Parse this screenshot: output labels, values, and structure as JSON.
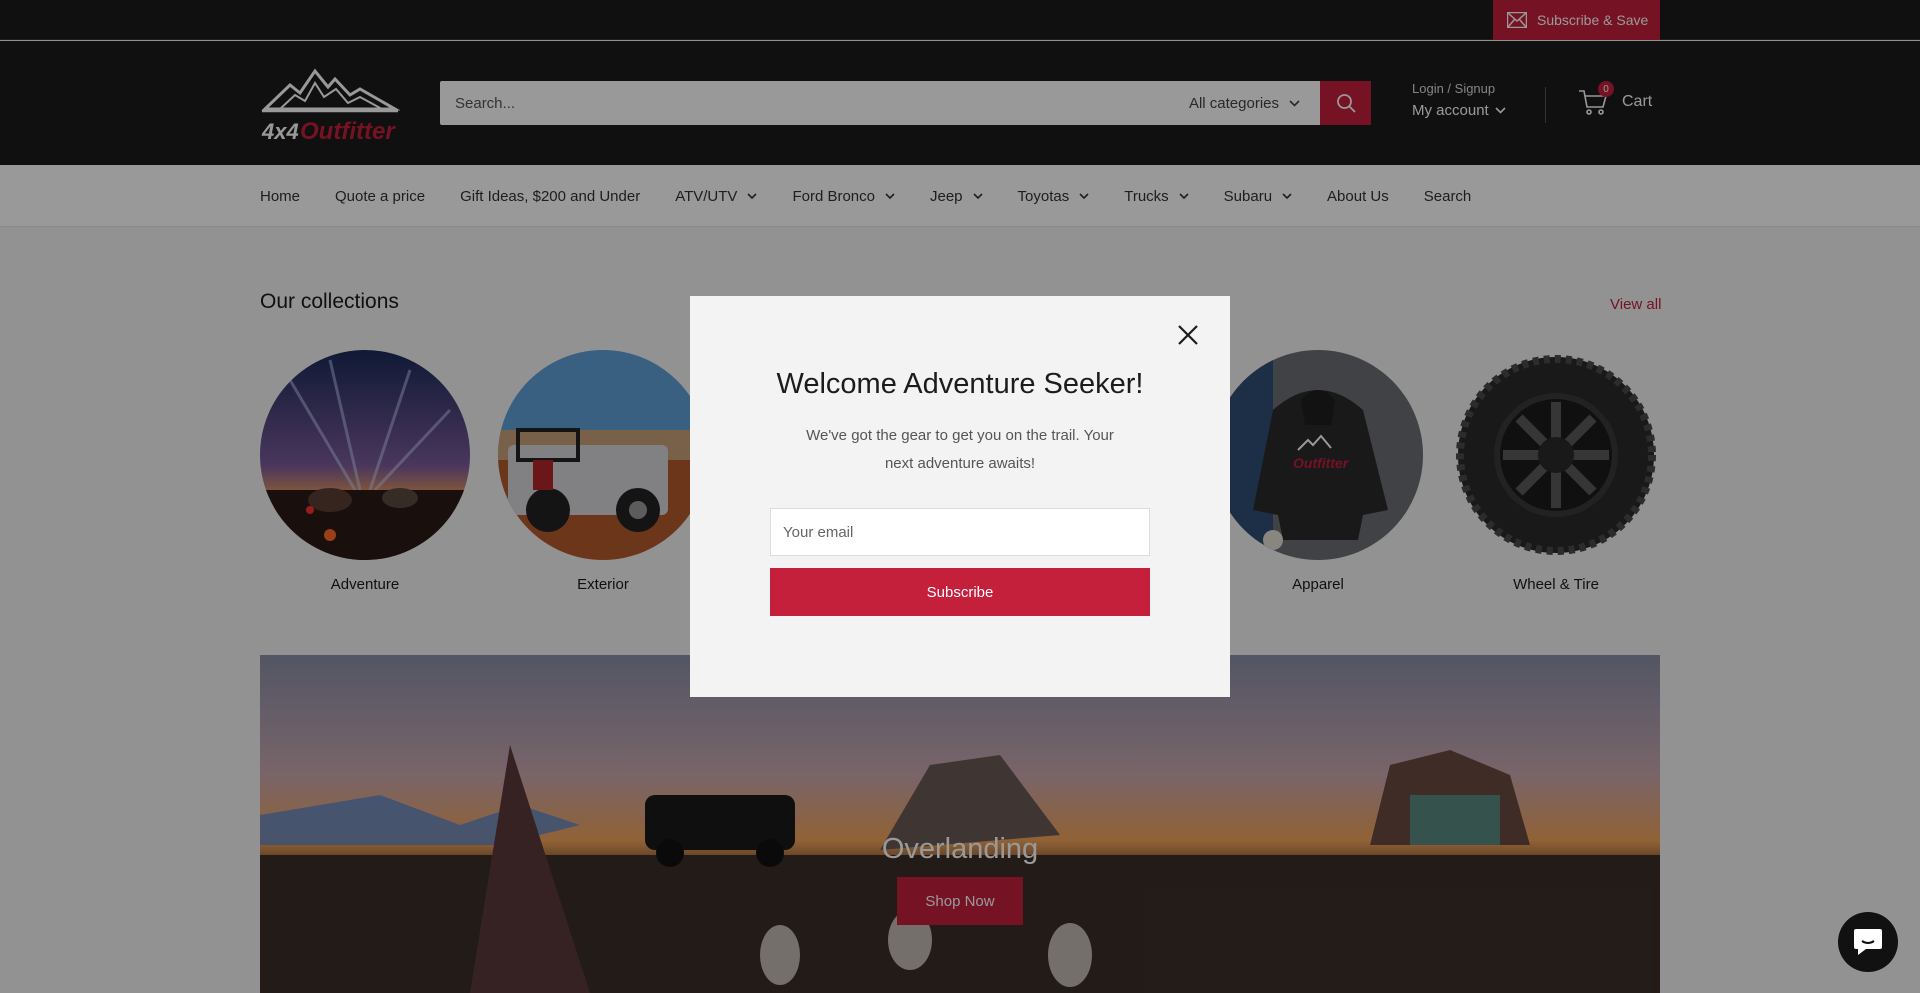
{
  "topbar": {
    "subscribe_label": "Subscribe & Save"
  },
  "header": {
    "logo_text": "4x4 Outfitter",
    "search_placeholder": "Search...",
    "category_label": "All categories",
    "account_small": "Login / Signup",
    "account_label": "My account",
    "cart_count": "0",
    "cart_label": "Cart"
  },
  "nav": {
    "items": [
      {
        "label": "Home",
        "dropdown": false
      },
      {
        "label": "Quote a price",
        "dropdown": false
      },
      {
        "label": "Gift Ideas, $200 and Under",
        "dropdown": false
      },
      {
        "label": "ATV/UTV",
        "dropdown": true
      },
      {
        "label": "Ford Bronco",
        "dropdown": true
      },
      {
        "label": "Jeep",
        "dropdown": true
      },
      {
        "label": "Toyotas",
        "dropdown": true
      },
      {
        "label": "Trucks",
        "dropdown": true
      },
      {
        "label": "Subaru",
        "dropdown": true
      },
      {
        "label": "About Us",
        "dropdown": false
      },
      {
        "label": "Search",
        "dropdown": false
      }
    ]
  },
  "collections": {
    "title": "Our collections",
    "view_all": "View all",
    "items": [
      {
        "label": "Adventure"
      },
      {
        "label": "Exterior"
      },
      {
        "label": "Apparel"
      },
      {
        "label": "Wheel & Tire"
      }
    ]
  },
  "banner": {
    "title": "Overlanding",
    "button": "Shop Now"
  },
  "modal": {
    "title": "Welcome Adventure Seeker!",
    "text": "We've got the gear to get you on the trail. Your next adventure awaits!",
    "email_placeholder": "Your email",
    "submit_label": "Subscribe"
  },
  "colors": {
    "accent": "#c41f3b",
    "header_bg": "#1c1b1d"
  }
}
